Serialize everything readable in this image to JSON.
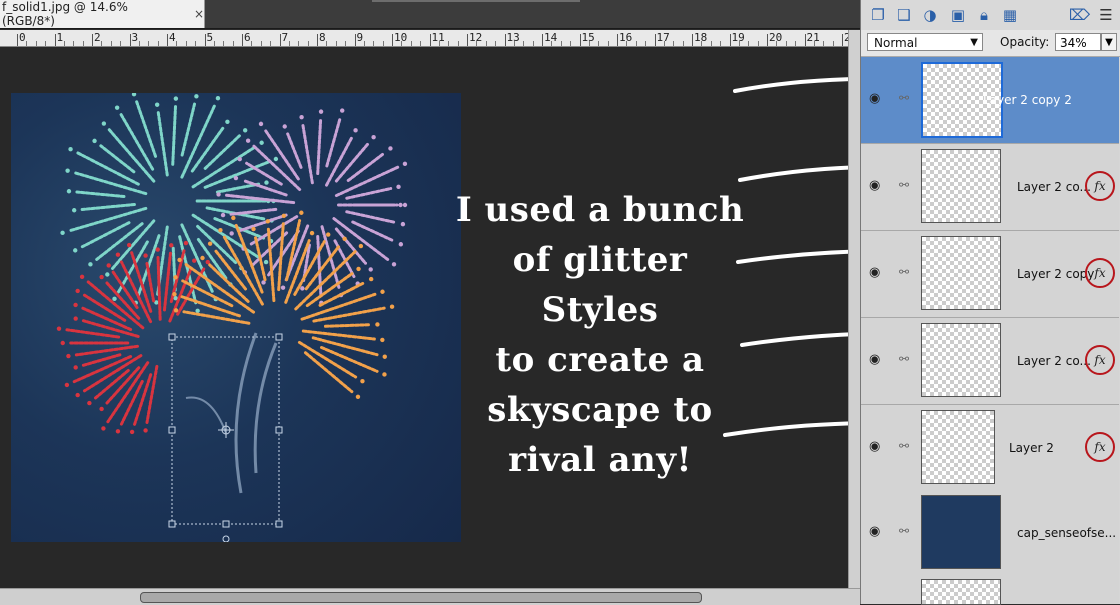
{
  "document_tab": {
    "title": "f_solid1.jpg @ 14.6% (RGB/8*)",
    "close_symbol": "×"
  },
  "ruler": {
    "labels": [
      "0",
      "1",
      "2",
      "3",
      "4",
      "5",
      "6",
      "7",
      "8",
      "9",
      "10",
      "11",
      "12",
      "13",
      "14",
      "15",
      "16",
      "17",
      "18",
      "19",
      "20",
      "21",
      "2"
    ]
  },
  "caption": {
    "lines": [
      "I used a bunch",
      "of glitter Styles",
      "to create a",
      "skyscape to",
      "rival any!"
    ]
  },
  "layers_panel": {
    "blend_mode": "Normal",
    "opacity_label": "Opacity:",
    "opacity_value": "34%",
    "layers": [
      {
        "name": "Layer 2 copy 2",
        "selected": true,
        "fx": false
      },
      {
        "name": "Layer 2 co...",
        "selected": false,
        "fx": true
      },
      {
        "name": "Layer 2 copy",
        "selected": false,
        "fx": true
      },
      {
        "name": "Layer 2 co...",
        "selected": false,
        "fx": true
      },
      {
        "name": "Layer 2",
        "selected": false,
        "fx": true
      },
      {
        "name": "cap_senseofse...",
        "selected": false,
        "fx": false
      }
    ],
    "fx_label": "fx"
  },
  "colors": {
    "accent": "#5d8cc9",
    "fx_ring": "#b8161c",
    "canvas_bg": "#282828"
  },
  "icons": [
    "new-layer-icon",
    "duplicate-layer-icon",
    "fill-adjustment-icon",
    "mask-icon",
    "lock-icon",
    "lock-transparency-icon",
    "trash-icon",
    "panel-menu-icon"
  ]
}
